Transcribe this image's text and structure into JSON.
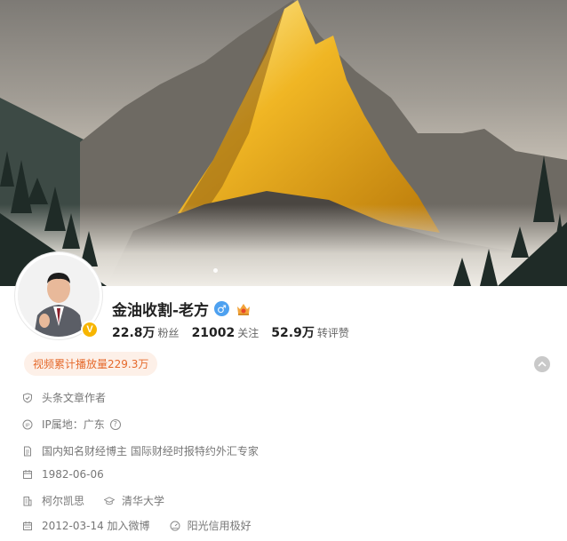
{
  "profile": {
    "name": "金油收割-老方",
    "avatar_badge": "V",
    "gender_icon": "male-icon",
    "gender_glyph": "♂",
    "medal_icon": "crown-medal-icon"
  },
  "stats": [
    {
      "value": "22.8万",
      "label": "粉丝"
    },
    {
      "value": "21002",
      "label": "关注"
    },
    {
      "value": "52.9万",
      "label": "转评赞"
    }
  ],
  "play_badge": "视频累计播放量229.3万",
  "info": {
    "author_tag": "头条文章作者",
    "ip_location": "IP属地：广东",
    "ip_help": "?",
    "bio": "国内知名财经博主 国际财经时报特约外汇专家",
    "birthday": "1982-06-06",
    "company": "柯尔凯思",
    "school": "清华大学",
    "joined": "2012-03-14 加入微博",
    "credit": "阳光信用极好"
  },
  "colors": {
    "accent_orange": "#e5692b",
    "badge_bg": "#fdf0e8",
    "verify_gold": "#f7b500",
    "gender_blue": "#4ea1f0"
  }
}
